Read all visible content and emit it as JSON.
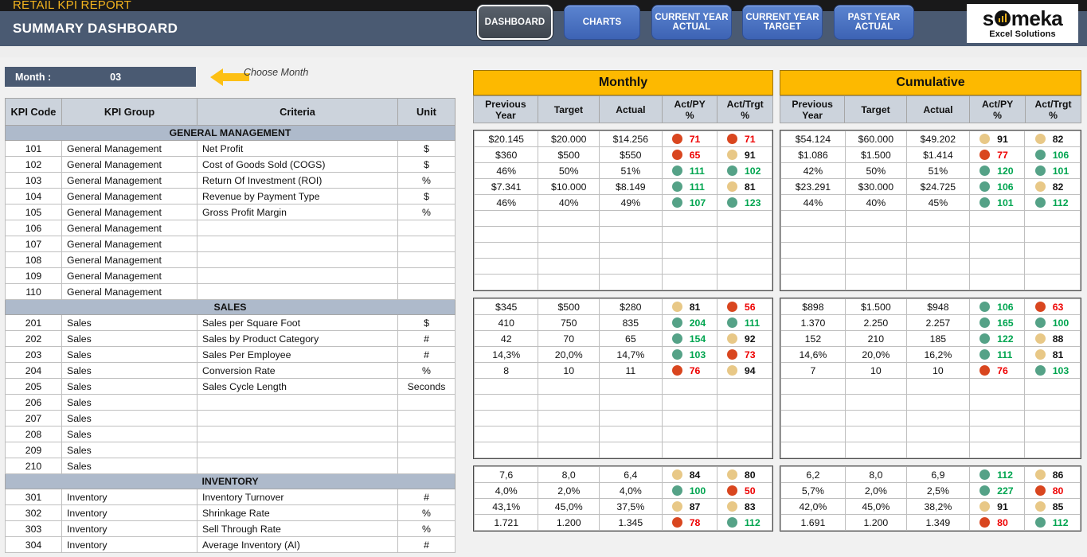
{
  "header": {
    "app_title": "RETAIL KPI REPORT",
    "subtitle": "SUMMARY DASHBOARD",
    "nav": [
      {
        "id": "dashboard",
        "label": "DASHBOARD",
        "active": true
      },
      {
        "id": "charts",
        "label": "CHARTS",
        "active": false
      },
      {
        "id": "current-year-actual",
        "label": "CURRENT YEAR\nACTUAL",
        "line1": "CURRENT YEAR",
        "line2": "ACTUAL",
        "active": false
      },
      {
        "id": "current-year-target",
        "label": "CURRENT YEAR\nTARGET",
        "line1": "CURRENT YEAR",
        "line2": "TARGET",
        "active": false
      },
      {
        "id": "past-year-actual",
        "label": "PAST YEAR\nACTUAL",
        "line1": "PAST YEAR",
        "line2": "ACTUAL",
        "active": false
      }
    ],
    "logo": {
      "name": "someka",
      "tagline": "Excel Solutions"
    }
  },
  "month_selector": {
    "label": "Month :",
    "value": "03",
    "hint": "Choose Month"
  },
  "left_table": {
    "columns": [
      "KPI Code",
      "KPI Group",
      "Criteria",
      "Unit"
    ],
    "sections": [
      {
        "title": "GENERAL MANAGEMENT",
        "rows": [
          {
            "code": "101",
            "group": "General Management",
            "criteria": "Net Profit",
            "unit": "$"
          },
          {
            "code": "102",
            "group": "General Management",
            "criteria": "Cost of Goods Sold (COGS)",
            "unit": "$"
          },
          {
            "code": "103",
            "group": "General Management",
            "criteria": "Return Of Investment (ROI)",
            "unit": "%"
          },
          {
            "code": "104",
            "group": "General Management",
            "criteria": "Revenue by Payment Type",
            "unit": "$"
          },
          {
            "code": "105",
            "group": "General Management",
            "criteria": "Gross Profit Margin",
            "unit": "%"
          },
          {
            "code": "106",
            "group": "General Management",
            "criteria": "",
            "unit": ""
          },
          {
            "code": "107",
            "group": "General Management",
            "criteria": "",
            "unit": ""
          },
          {
            "code": "108",
            "group": "General Management",
            "criteria": "",
            "unit": ""
          },
          {
            "code": "109",
            "group": "General Management",
            "criteria": "",
            "unit": ""
          },
          {
            "code": "110",
            "group": "General Management",
            "criteria": "",
            "unit": ""
          }
        ]
      },
      {
        "title": "SALES",
        "rows": [
          {
            "code": "201",
            "group": "Sales",
            "criteria": "Sales per Square Foot",
            "unit": "$"
          },
          {
            "code": "202",
            "group": "Sales",
            "criteria": "Sales by Product Category",
            "unit": "#"
          },
          {
            "code": "203",
            "group": "Sales",
            "criteria": "Sales Per Employee",
            "unit": "#"
          },
          {
            "code": "204",
            "group": "Sales",
            "criteria": "Conversion Rate",
            "unit": "%"
          },
          {
            "code": "205",
            "group": "Sales",
            "criteria": "Sales Cycle Length",
            "unit": "Seconds"
          },
          {
            "code": "206",
            "group": "Sales",
            "criteria": "",
            "unit": ""
          },
          {
            "code": "207",
            "group": "Sales",
            "criteria": "",
            "unit": ""
          },
          {
            "code": "208",
            "group": "Sales",
            "criteria": "",
            "unit": ""
          },
          {
            "code": "209",
            "group": "Sales",
            "criteria": "",
            "unit": ""
          },
          {
            "code": "210",
            "group": "Sales",
            "criteria": "",
            "unit": ""
          }
        ]
      },
      {
        "title": "INVENTORY",
        "rows": [
          {
            "code": "301",
            "group": "Inventory",
            "criteria": "Inventory Turnover",
            "unit": "#"
          },
          {
            "code": "302",
            "group": "Inventory",
            "criteria": "Shrinkage Rate",
            "unit": "%"
          },
          {
            "code": "303",
            "group": "Inventory",
            "criteria": "Sell Through Rate",
            "unit": "%"
          },
          {
            "code": "304",
            "group": "Inventory",
            "criteria": "Average Inventory (AI)",
            "unit": "#"
          }
        ]
      }
    ]
  },
  "panels": [
    {
      "id": "monthly",
      "title": "Monthly",
      "columns": [
        "Previous Year",
        "Target",
        "Actual",
        "Act/PY %",
        "Act/Trgt %"
      ],
      "column_lines": [
        {
          "l1": "Previous",
          "l2": "Year"
        },
        {
          "l1": "Target",
          "l2": ""
        },
        {
          "l1": "Actual",
          "l2": ""
        },
        {
          "l1": "Act/PY",
          "l2": "%"
        },
        {
          "l1": "Act/Trgt",
          "l2": "%"
        }
      ],
      "blocks": [
        {
          "section": "GENERAL MANAGEMENT",
          "rows": [
            {
              "py": "$20.145",
              "target": "$20.000",
              "actual": "$14.256",
              "apy": "71",
              "apy_status": "red",
              "atg": "71",
              "atg_status": "red"
            },
            {
              "py": "$360",
              "target": "$500",
              "actual": "$550",
              "apy": "65",
              "apy_status": "red",
              "atg": "91",
              "atg_status": "yellow"
            },
            {
              "py": "46%",
              "target": "50%",
              "actual": "51%",
              "apy": "111",
              "apy_status": "green",
              "atg": "102",
              "atg_status": "green"
            },
            {
              "py": "$7.341",
              "target": "$10.000",
              "actual": "$8.149",
              "apy": "111",
              "apy_status": "green",
              "atg": "81",
              "atg_status": "yellow"
            },
            {
              "py": "46%",
              "target": "40%",
              "actual": "49%",
              "apy": "107",
              "apy_status": "green",
              "atg": "123",
              "atg_status": "green"
            }
          ],
          "empty_rows": 5
        },
        {
          "section": "SALES",
          "rows": [
            {
              "py": "$345",
              "target": "$500",
              "actual": "$280",
              "apy": "81",
              "apy_status": "yellow",
              "atg": "56",
              "atg_status": "red"
            },
            {
              "py": "410",
              "target": "750",
              "actual": "835",
              "apy": "204",
              "apy_status": "green",
              "atg": "111",
              "atg_status": "green"
            },
            {
              "py": "42",
              "target": "70",
              "actual": "65",
              "apy": "154",
              "apy_status": "green",
              "atg": "92",
              "atg_status": "yellow"
            },
            {
              "py": "14,3%",
              "target": "20,0%",
              "actual": "14,7%",
              "apy": "103",
              "apy_status": "green",
              "atg": "73",
              "atg_status": "red"
            },
            {
              "py": "8",
              "target": "10",
              "actual": "11",
              "apy": "76",
              "apy_status": "red",
              "atg": "94",
              "atg_status": "yellow"
            }
          ],
          "empty_rows": 5
        },
        {
          "section": "INVENTORY",
          "rows": [
            {
              "py": "7,6",
              "target": "8,0",
              "actual": "6,4",
              "apy": "84",
              "apy_status": "yellow",
              "atg": "80",
              "atg_status": "yellow"
            },
            {
              "py": "4,0%",
              "target": "2,0%",
              "actual": "4,0%",
              "apy": "100",
              "apy_status": "green",
              "atg": "50",
              "atg_status": "red"
            },
            {
              "py": "43,1%",
              "target": "45,0%",
              "actual": "37,5%",
              "apy": "87",
              "apy_status": "yellow",
              "atg": "83",
              "atg_status": "yellow"
            },
            {
              "py": "1.721",
              "target": "1.200",
              "actual": "1.345",
              "apy": "78",
              "apy_status": "red",
              "atg": "112",
              "atg_status": "green"
            }
          ],
          "empty_rows": 0
        }
      ]
    },
    {
      "id": "cumulative",
      "title": "Cumulative",
      "columns": [
        "Previous Year",
        "Target",
        "Actual",
        "Act/PY %",
        "Act/Trgt %"
      ],
      "column_lines": [
        {
          "l1": "Previous",
          "l2": "Year"
        },
        {
          "l1": "Target",
          "l2": ""
        },
        {
          "l1": "Actual",
          "l2": ""
        },
        {
          "l1": "Act/PY",
          "l2": "%"
        },
        {
          "l1": "Act/Trgt",
          "l2": "%"
        }
      ],
      "blocks": [
        {
          "section": "GENERAL MANAGEMENT",
          "rows": [
            {
              "py": "$54.124",
              "target": "$60.000",
              "actual": "$49.202",
              "apy": "91",
              "apy_status": "yellow",
              "atg": "82",
              "atg_status": "yellow"
            },
            {
              "py": "$1.086",
              "target": "$1.500",
              "actual": "$1.414",
              "apy": "77",
              "apy_status": "red",
              "atg": "106",
              "atg_status": "green"
            },
            {
              "py": "42%",
              "target": "50%",
              "actual": "51%",
              "apy": "120",
              "apy_status": "green",
              "atg": "101",
              "atg_status": "green"
            },
            {
              "py": "$23.291",
              "target": "$30.000",
              "actual": "$24.725",
              "apy": "106",
              "apy_status": "green",
              "atg": "82",
              "atg_status": "yellow"
            },
            {
              "py": "44%",
              "target": "40%",
              "actual": "45%",
              "apy": "101",
              "apy_status": "green",
              "atg": "112",
              "atg_status": "green"
            }
          ],
          "empty_rows": 5
        },
        {
          "section": "SALES",
          "rows": [
            {
              "py": "$898",
              "target": "$1.500",
              "actual": "$948",
              "apy": "106",
              "apy_status": "green",
              "atg": "63",
              "atg_status": "red"
            },
            {
              "py": "1.370",
              "target": "2.250",
              "actual": "2.257",
              "apy": "165",
              "apy_status": "green",
              "atg": "100",
              "atg_status": "green"
            },
            {
              "py": "152",
              "target": "210",
              "actual": "185",
              "apy": "122",
              "apy_status": "green",
              "atg": "88",
              "atg_status": "yellow"
            },
            {
              "py": "14,6%",
              "target": "20,0%",
              "actual": "16,2%",
              "apy": "111",
              "apy_status": "green",
              "atg": "81",
              "atg_status": "yellow"
            },
            {
              "py": "7",
              "target": "10",
              "actual": "10",
              "apy": "76",
              "apy_status": "red",
              "atg": "103",
              "atg_status": "green"
            }
          ],
          "empty_rows": 5
        },
        {
          "section": "INVENTORY",
          "rows": [
            {
              "py": "6,2",
              "target": "8,0",
              "actual": "6,9",
              "apy": "112",
              "apy_status": "green",
              "atg": "86",
              "atg_status": "yellow"
            },
            {
              "py": "5,7%",
              "target": "2,0%",
              "actual": "2,5%",
              "apy": "227",
              "apy_status": "green",
              "atg": "80",
              "atg_status": "red"
            },
            {
              "py": "42,0%",
              "target": "45,0%",
              "actual": "38,2%",
              "apy": "91",
              "apy_status": "yellow",
              "atg": "85",
              "atg_status": "yellow"
            },
            {
              "py": "1.691",
              "target": "1.200",
              "actual": "1.349",
              "apy": "80",
              "apy_status": "red",
              "atg": "112",
              "atg_status": "green"
            }
          ],
          "empty_rows": 0
        }
      ]
    }
  ],
  "colors": {
    "brand_dark": "#19191a",
    "brand_blue": "#4a5a72",
    "accent_yellow": "#f3b31e",
    "panel_title_bg": "#fdb900",
    "header_bg": "#ccd3dc",
    "section_bg": "#aebacb",
    "status_red": "#d9461f",
    "status_yellow": "#e8c887",
    "status_green": "#55a287",
    "text_red": "#ee0000",
    "text_green": "#00a550",
    "text_dark": "#111111",
    "nav_blue": "#3d63b4"
  }
}
